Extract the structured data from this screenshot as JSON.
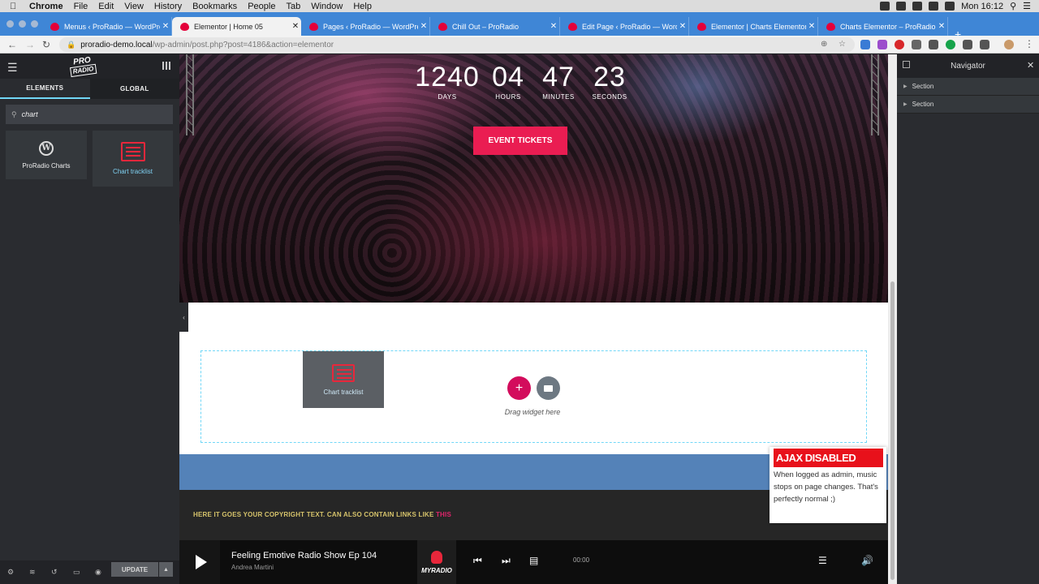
{
  "menubar": {
    "app": "Chrome",
    "items": [
      "File",
      "Edit",
      "View",
      "History",
      "Bookmarks",
      "People",
      "Tab",
      "Window",
      "Help"
    ],
    "clock": "Mon 16:12"
  },
  "tabs": [
    {
      "title": "Menus ‹ ProRadio — WordPress"
    },
    {
      "title": "Elementor | Home 05"
    },
    {
      "title": "Pages ‹ ProRadio — WordPress"
    },
    {
      "title": "Chill Out – ProRadio"
    },
    {
      "title": "Edit Page ‹ ProRadio — WordPress"
    },
    {
      "title": "Elementor | Charts Elementor"
    },
    {
      "title": "Charts Elementor – ProRadio"
    }
  ],
  "address": {
    "host": "proradio-demo.local",
    "path": "/wp-admin/post.php?post=4186&action=elementor"
  },
  "panel": {
    "logo_top": "PRO",
    "logo_bottom": "RADIO",
    "tab_elements": "ELEMENTS",
    "tab_global": "GLOBAL",
    "search_value": "chart",
    "widgets": [
      {
        "label": "ProRadio Charts",
        "icon": "wordpress-icon"
      },
      {
        "label": "Chart tracklist",
        "icon": "chart-tracklist-icon"
      }
    ],
    "update_label": "UPDATE"
  },
  "hero": {
    "countdown": [
      {
        "value": "1240",
        "label": "DAYS"
      },
      {
        "value": "04",
        "label": "HOURS"
      },
      {
        "value": "47",
        "label": "MINUTES"
      },
      {
        "value": "23",
        "label": "SECONDS"
      }
    ],
    "cta": "EVENT TICKETS"
  },
  "dropzone": {
    "dragged_widget": "Chart tracklist",
    "hint": "Drag widget here"
  },
  "footer": {
    "copyright": "HERE IT GOES YOUR COPYRIGHT TEXT. CAN ALSO CONTAIN LINKS LIKE",
    "link": "THIS"
  },
  "player": {
    "title": "Feeling Emotive Radio Show Ep 104",
    "artist": "Andrea Martini",
    "logo": "MYRADIO",
    "time": "00:00"
  },
  "navigator": {
    "title": "Navigator",
    "items": [
      "Section",
      "Section"
    ]
  },
  "ajax_notice": {
    "title": "AJAX DISABLED",
    "body": "When logged as admin, music stops on page changes. That's perfectly normal ;)"
  },
  "colors": {
    "accent_pink": "#ea1d52",
    "chrome_blue": "#3f86d6",
    "panel_dark": "#2a2c30",
    "dropzone_border": "#71d7f7",
    "copyright_yellow": "#d6c36b"
  }
}
